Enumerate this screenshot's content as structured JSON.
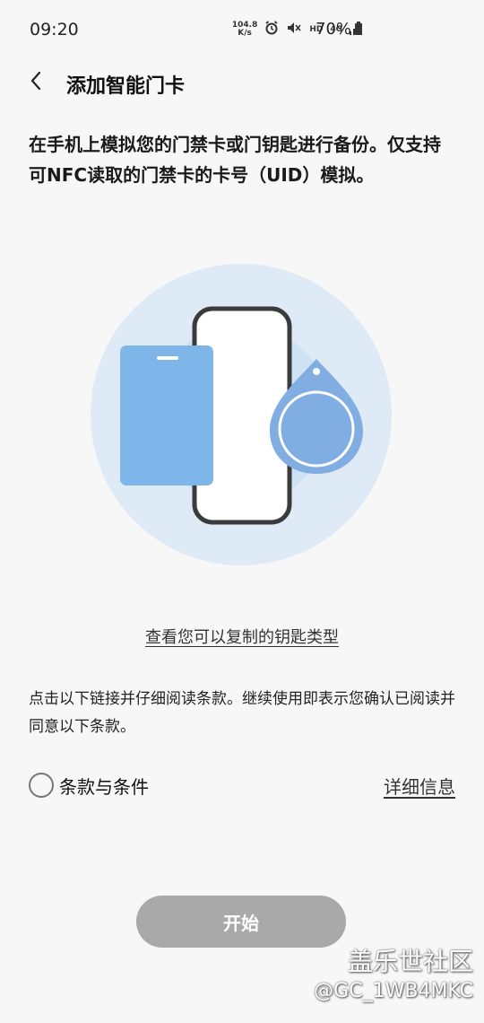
{
  "status_bar": {
    "time": "09:20",
    "net_speed_value": "104.8",
    "net_speed_unit": "K/s",
    "hd": "HD",
    "network": "4G",
    "battery": "70%"
  },
  "header": {
    "title": "添加智能门卡"
  },
  "intro": {
    "text": "在手机上模拟您的门禁卡或门钥匙进行备份。仅支持可NFC读取的门禁卡的卡号（UID）模拟。"
  },
  "links": {
    "copy_types": "查看您可以复制的钥匙类型"
  },
  "terms": {
    "note": "点击以下链接并仔细阅读条款。继续使用即表示您确认已阅读并同意以下条款。",
    "checkbox_label": "条款与条件",
    "details_link": "详细信息",
    "checked": false
  },
  "actions": {
    "start_label": "开始",
    "start_enabled": false
  },
  "watermark": {
    "line1": "盖乐世社区",
    "line2": "@GC_1WB4MKC"
  },
  "colors": {
    "background": "#f7f7f7",
    "illustration_circle": "#deebf6",
    "card_blue": "#7fb6ea",
    "fob_blue": "#80ade2",
    "button_disabled": "#a9a9a9"
  },
  "icons": {
    "back": "chevron-left-icon",
    "alarm": "alarm-icon",
    "mute": "mute-icon",
    "signal": "signal-icon",
    "battery": "battery-icon"
  }
}
